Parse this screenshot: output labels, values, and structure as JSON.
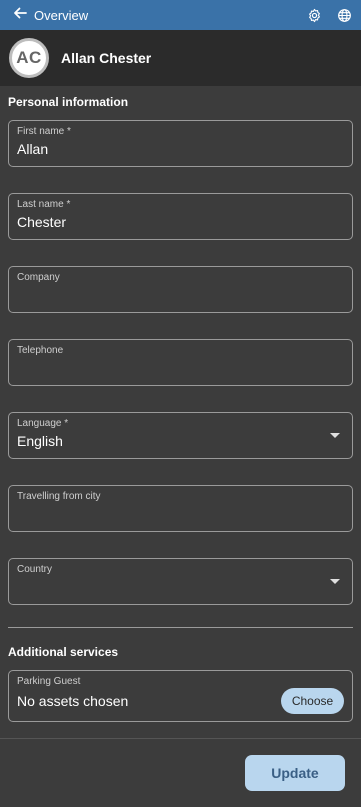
{
  "header": {
    "back_label": "Overview",
    "icons": [
      "arrow-left-icon",
      "gear-icon",
      "globe-icon"
    ],
    "bg_color": "#3a72a8"
  },
  "user": {
    "initials": "AC",
    "name": "Allan Chester"
  },
  "personal_section": {
    "title": "Personal information",
    "fields": {
      "first_name": {
        "label": "First name *",
        "value": "Allan"
      },
      "last_name": {
        "label": "Last name *",
        "value": "Chester"
      },
      "company": {
        "label": "Company",
        "value": ""
      },
      "telephone": {
        "label": "Telephone",
        "value": ""
      },
      "language": {
        "label": "Language *",
        "value": "English"
      },
      "travelling_from_city": {
        "label": "Travelling from city",
        "value": ""
      },
      "country": {
        "label": "Country",
        "value": ""
      }
    }
  },
  "additional_section": {
    "title": "Additional services",
    "parking": {
      "label": "Parking Guest",
      "value": "No assets chosen",
      "button_label": "Choose"
    }
  },
  "footer": {
    "update_label": "Update"
  },
  "colors": {
    "accent": "#3a72a8",
    "button_bg": "#b9d6ee",
    "page_bg": "#3c3c3c"
  }
}
